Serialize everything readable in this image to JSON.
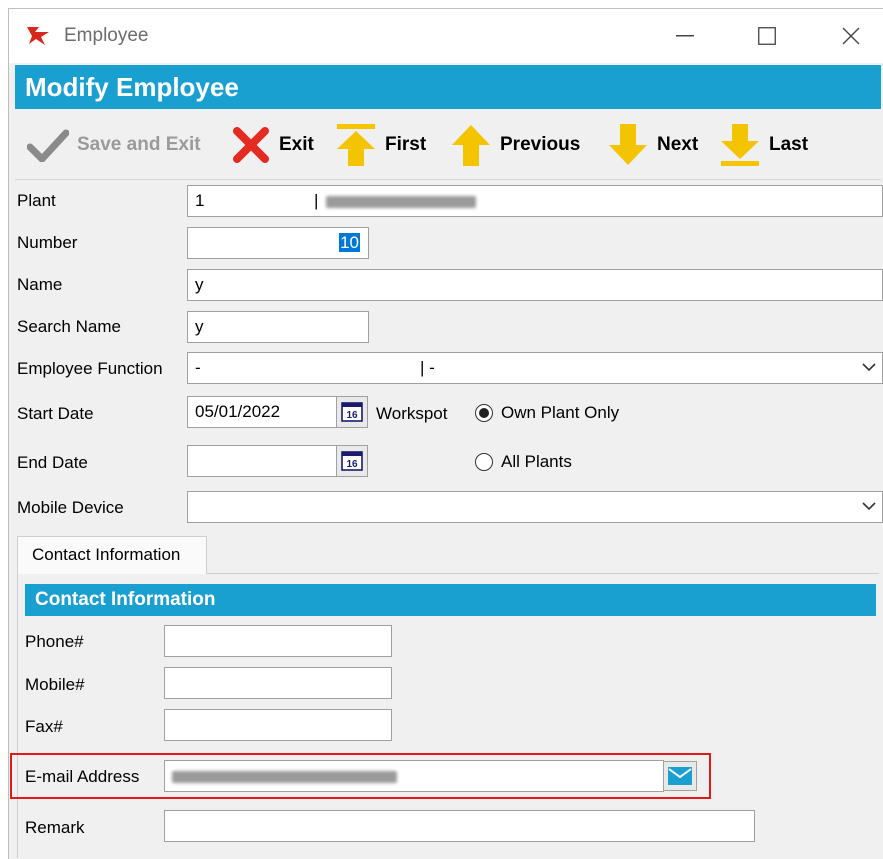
{
  "window": {
    "title": "Employee"
  },
  "header": {
    "title": "Modify Employee"
  },
  "toolbar": {
    "save_exit": "Save and Exit",
    "exit": "Exit",
    "first": "First",
    "previous": "Previous",
    "next": "Next",
    "last": "Last"
  },
  "form": {
    "plant_label": "Plant",
    "plant_value": "1",
    "plant_separator": "|",
    "number_label": "Number",
    "number_value": "10",
    "name_label": "Name",
    "name_value": "y",
    "search_name_label": "Search Name",
    "search_name_value": "y",
    "function_label": "Employee Function",
    "function_value": "-",
    "function_separator": "| -",
    "start_date_label": "Start Date",
    "start_date_value": "05/01/2022",
    "calendar_day": "16",
    "workspot_label": "Workspot",
    "workspot_own": "Own Plant Only",
    "workspot_all": "All Plants",
    "workspot_selected": "Own Plant Only",
    "end_date_label": "End Date",
    "end_date_value": "",
    "mobile_label": "Mobile Device",
    "mobile_value": ""
  },
  "tabs": [
    {
      "label": "Contact Information"
    }
  ],
  "contact": {
    "section_title": "Contact Information",
    "phone_label": "Phone#",
    "phone_value": "",
    "mobile_label": "Mobile#",
    "mobile_value": "",
    "fax_label": "Fax#",
    "fax_value": "",
    "email_label": "E-mail Address",
    "remark_label": "Remark",
    "remark_value": ""
  },
  "colors": {
    "header": "#1aa0d0",
    "highlight": "#e01919",
    "arrow": "#f5c400",
    "exit_red": "#e32b22",
    "check_gray": "#8a8a8a"
  },
  "icons": [
    "app-logo-icon",
    "minimize-icon",
    "maximize-icon",
    "close-icon",
    "checkmark-icon",
    "x-icon",
    "arrow-top-icon",
    "arrow-up-icon",
    "arrow-down-icon",
    "arrow-bottom-icon",
    "calendar-icon",
    "chevron-down-icon",
    "mail-icon"
  ]
}
